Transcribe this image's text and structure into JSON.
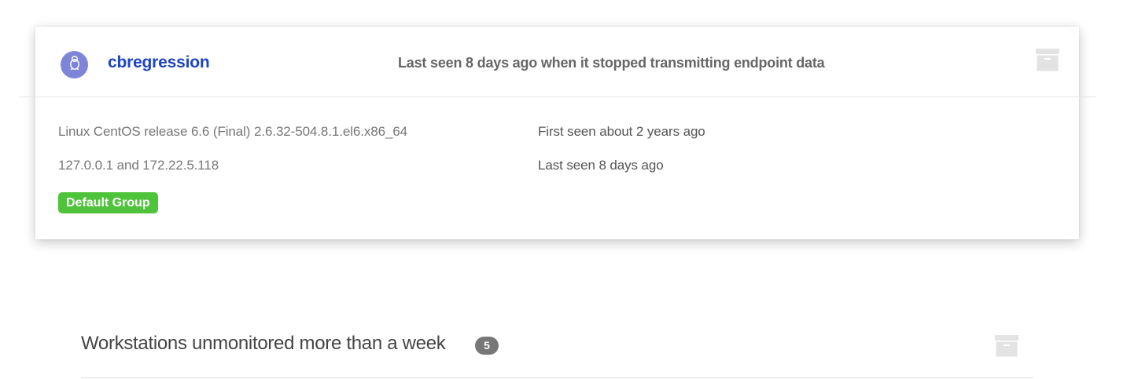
{
  "endpoint_card": {
    "host_name": "cbregression",
    "avatar_icon": "linux-penguin-icon",
    "avatar_color": "#7e85d8",
    "status_line": "Last seen 8 days ago when it stopped transmitting endpoint data",
    "archive_icon": "archive-box-icon",
    "os": "Linux CentOS release 6.6 (Final) 2.6.32-504.8.1.el6.x86_64",
    "ip_addresses": "127.0.0.1 and 172.22.5.118",
    "group_badge": "Default Group",
    "group_color": "#4fc33b",
    "first_seen": "First seen about 2 years ago",
    "last_seen": "Last seen 8 days ago"
  },
  "section": {
    "title": "Workstations unmonitored more than a week",
    "count": "5",
    "archive_icon": "archive-box-icon"
  },
  "colors": {
    "link": "#1f44c2",
    "muted_text": "#777777",
    "icon_gray": "#e3e3e3"
  }
}
